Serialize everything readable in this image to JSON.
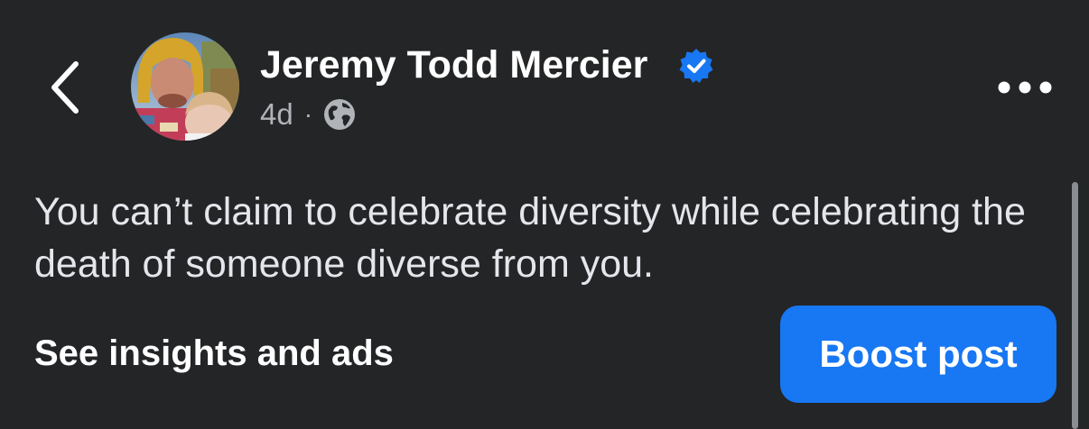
{
  "header": {
    "author_name": "Jeremy Todd Mercier",
    "timestamp": "4d",
    "separator": "·",
    "audience_icon": "globe-icon",
    "verified_icon": "verified-badge-icon",
    "back_icon": "chevron-left-icon",
    "more_icon": "more-horizontal-icon"
  },
  "post": {
    "text": "You can’t claim to celebrate diversity while celebrating the death of someone diverse from you."
  },
  "actions": {
    "insights_label": "See insights and ads",
    "boost_label": "Boost post"
  },
  "colors": {
    "background": "#242526",
    "accent": "#1877f2",
    "primary_text": "#e4e6eb",
    "secondary_text": "#b0b3b8"
  }
}
